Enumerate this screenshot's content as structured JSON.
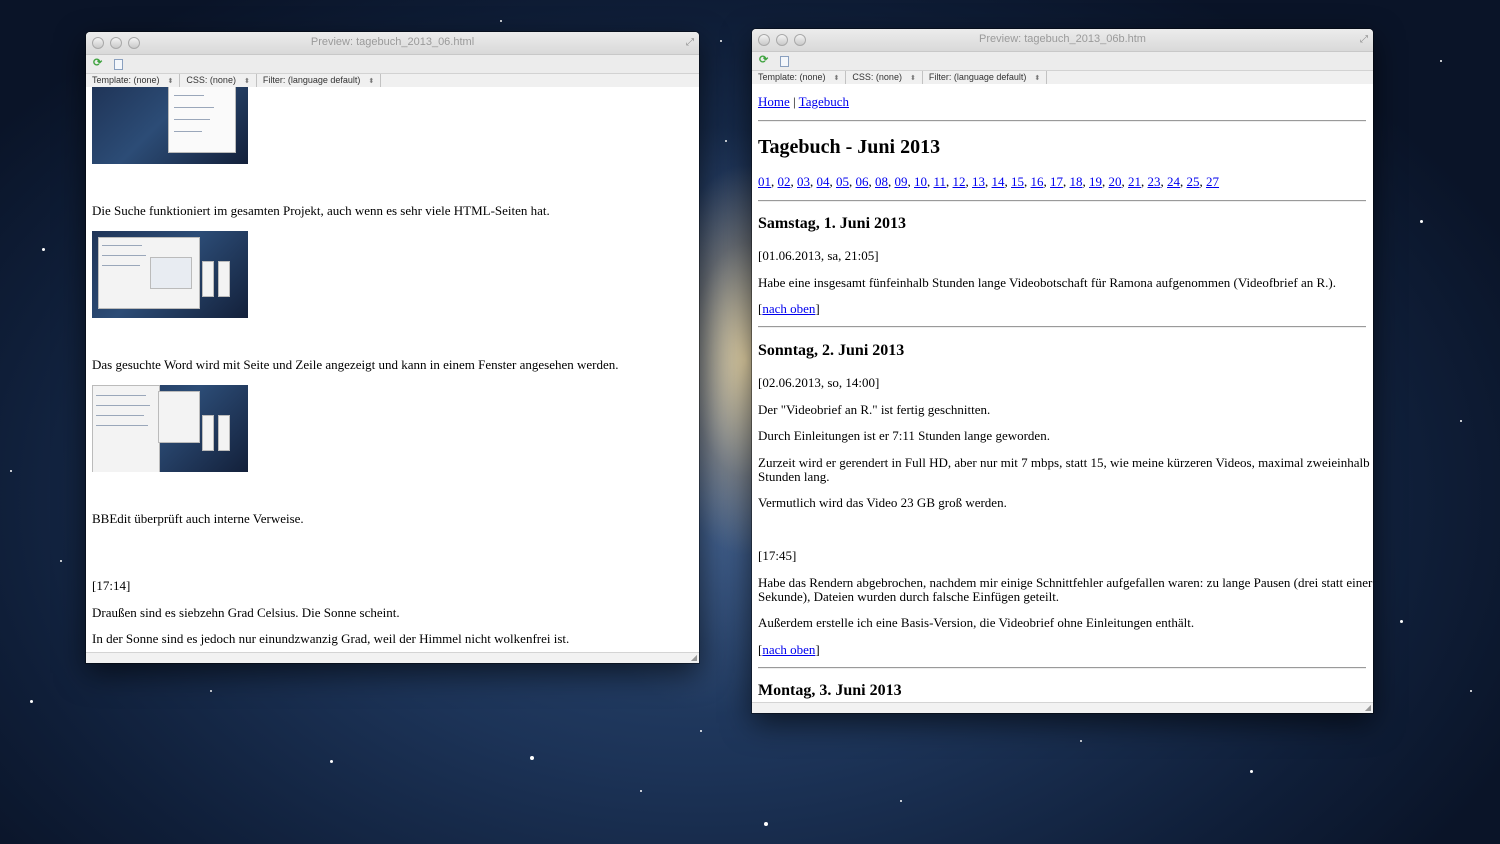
{
  "left_window": {
    "title": "Preview: tagebuch_2013_06.html",
    "template_select": "Template: (none)",
    "css_select": "CSS: (none)",
    "filter_select": "Filter: (language default)",
    "paragraphs": {
      "p1": "Die Suche funktioniert im gesamten Projekt, auch wenn es sehr viele HTML-Seiten hat.",
      "p2": "Das gesuchte Word wird mit Seite und Zeile angezeigt und kann in einem Fenster angesehen werden.",
      "p3": "BBEdit überprüft auch interne Verweise.",
      "time": "[17:14]",
      "p4": "Draußen sind es siebzehn Grad Celsius. Die Sonne scheint.",
      "p5": "In der Sonne sind es jedoch nur einundzwanzig Grad, weil der Himmel nicht wolkenfrei ist."
    }
  },
  "right_window": {
    "title": "Preview: tagebuch_2013_06b.htm",
    "template_select": "Template: (none)",
    "css_select": "CSS: (none)",
    "filter_select": "Filter: (language default)",
    "nav": {
      "home": "Home",
      "sep": "|",
      "diary": "Tagebuch"
    },
    "heading": "Tagebuch - Juni 2013",
    "days": [
      "01",
      "02",
      "03",
      "04",
      "05",
      "06",
      "08",
      "09",
      "10",
      "11",
      "12",
      "13",
      "14",
      "15",
      "16",
      "17",
      "18",
      "19",
      "20",
      "21",
      "23",
      "24",
      "25",
      "27"
    ],
    "day_separator": ",",
    "entry1": {
      "heading": "Samstag, 1. Juni 2013",
      "stamp": "[01.06.2013, sa, 21:05]",
      "text": "Habe eine insgesamt fünfeinhalb Stunden lange Videobotschaft für Ramona aufgenommen (Videofbrief an R.).",
      "top_link": "nach oben"
    },
    "entry2": {
      "heading": "Sonntag, 2. Juni 2013",
      "stamp": "[02.06.2013, so, 14:00]",
      "t1": "Der \"Videobrief an R.\" ist fertig geschnitten.",
      "t2": "Durch Einleitungen ist er 7:11 Stunden lange geworden.",
      "t3a": "Zurzeit wird er gerendert in Full HD, aber nur mit 7 mbps, statt 15, wie meine kürzeren Videos, maximal zweieinhalb",
      "t3b": "Stunden lang.",
      "t4": "Vermutlich wird das Video 23 GB groß werden.",
      "time": "[17:45]",
      "t5a": "Habe das Rendern abgebrochen, nachdem mir einige Schnittfehler aufgefallen waren: zu lange Pausen (drei statt einer",
      "t5b": "Sekunde), Dateien wurden durch falsche Einfügen geteilt.",
      "t6": "Außerdem erstelle ich eine Basis-Version, die Videobrief ohne Einleitungen enthält.",
      "top_link": "nach oben"
    },
    "entry3": {
      "heading": "Montag, 3. Juni 2013"
    }
  }
}
